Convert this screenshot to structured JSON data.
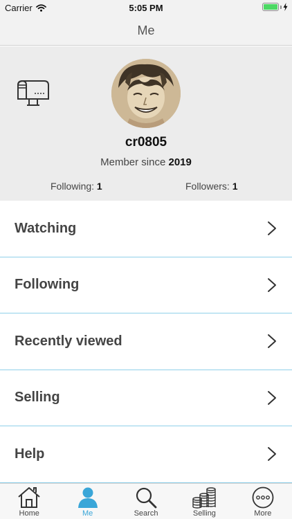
{
  "status_bar": {
    "carrier": "Carrier",
    "time": "5:05 PM",
    "wifi_icon": "wifi-icon",
    "battery_icon": "battery-icon",
    "battery_level": 1.0
  },
  "nav": {
    "title": "Me"
  },
  "profile": {
    "mailbox_icon": "mailbox-icon",
    "avatar": "avatar",
    "username": "cr0805",
    "member_since_label": "Member since",
    "member_since_year": "2019",
    "following_label": "Following:",
    "following_count": "1",
    "followers_label": "Followers:",
    "followers_count": "1"
  },
  "menu": {
    "items": [
      {
        "label": "Watching"
      },
      {
        "label": "Following"
      },
      {
        "label": "Recently viewed"
      },
      {
        "label": "Selling"
      },
      {
        "label": "Help"
      }
    ]
  },
  "tabs": [
    {
      "label": "Home",
      "icon": "home-icon"
    },
    {
      "label": "Me",
      "icon": "person-icon",
      "active": true
    },
    {
      "label": "Search",
      "icon": "search-icon"
    },
    {
      "label": "Selling",
      "icon": "coins-icon"
    },
    {
      "label": "More",
      "icon": "more-icon"
    }
  ],
  "colors": {
    "accent": "#3aa6d8",
    "divider": "#8fd0ea",
    "header_bg": "#ececec",
    "battery": "#4cd964"
  }
}
